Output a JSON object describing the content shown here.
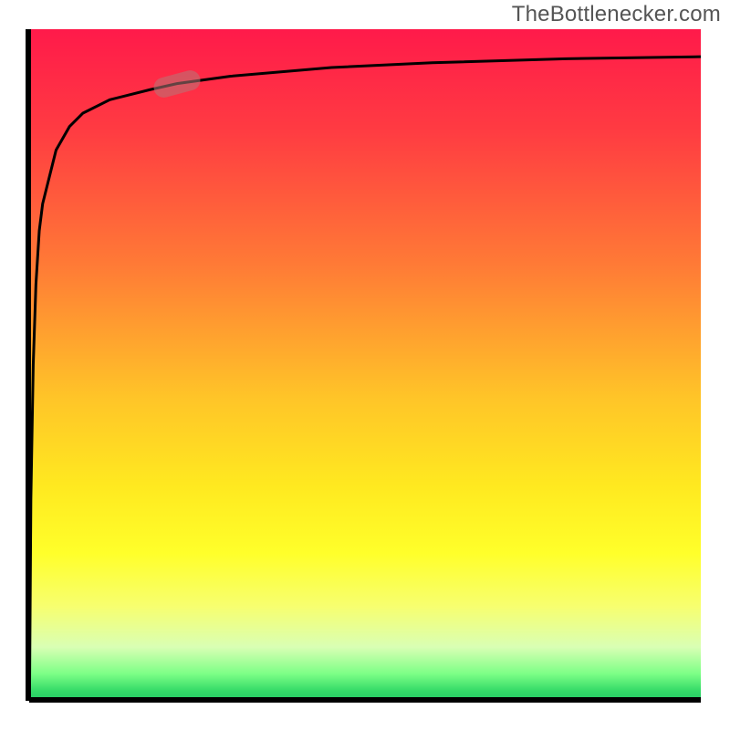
{
  "attribution": "TheBottlenecker.com",
  "chart_data": {
    "type": "line",
    "title": "",
    "xlabel": "",
    "ylabel": "",
    "xlim": [
      0,
      100
    ],
    "ylim": [
      0,
      100
    ],
    "x": [
      0,
      0.05,
      0.25,
      0.6,
      1.0,
      1.5,
      2.0,
      4.0,
      6.0,
      8.0,
      12.0,
      18.0,
      22.0,
      30.0,
      45.0,
      60.0,
      80.0,
      100.0
    ],
    "values": [
      100,
      0,
      30,
      50,
      62,
      70,
      74,
      82,
      85.5,
      87.5,
      89.5,
      91.0,
      91.9,
      93.0,
      94.3,
      95.0,
      95.6,
      95.9
    ],
    "marker": {
      "x": 22.0,
      "y": 91.9,
      "angle_deg": -15
    }
  },
  "colors": {
    "gradient_top": "#ff1a4a",
    "gradient_mid": "#ffe920",
    "gradient_bottom": "#22c964",
    "curve": "#000000",
    "marker": "rgba(180,120,120,0.55)"
  }
}
